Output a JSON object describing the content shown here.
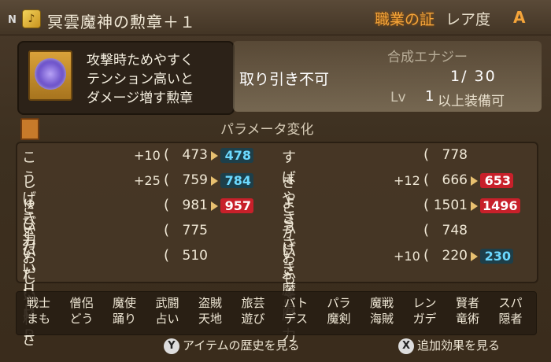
{
  "header": {
    "rank_badge": "N",
    "item_icon_glyph": "♪",
    "item_name": "冥雲魔神の勲章＋１",
    "job_proof": "職業の証",
    "rarity_label": "レア度",
    "rarity_value": "A"
  },
  "description": {
    "lines": [
      "攻撃時ためやすく",
      "テンション高いと",
      "ダメージ増す勲章"
    ]
  },
  "info": {
    "no_trade": "取り引き不可",
    "synth_label": "合成エナジー",
    "synth_value": "1/ 30",
    "lv_label": "Lv",
    "lv_value": "1",
    "lv_suffix": "以上装備可"
  },
  "params_title": "パラメータ変化",
  "params": {
    "left": [
      {
        "name": "こうげき力",
        "bonus": "+10",
        "cur": "473",
        "new": "478",
        "dir": "up"
      },
      {
        "name": "しゅび力",
        "bonus": "+25",
        "cur": "759",
        "new": "784",
        "dir": "up"
      },
      {
        "name": "さいだいＨＰ",
        "bonus": "",
        "cur": "981",
        "new": "957",
        "dir": "down"
      },
      {
        "name": "さいだいＭＰ",
        "bonus": "",
        "cur": "775",
        "new": "",
        "dir": ""
      },
      {
        "name": "おしゃれさ",
        "bonus": "",
        "cur": "510",
        "new": "",
        "dir": ""
      }
    ],
    "right": [
      {
        "name": "すばやさ",
        "bonus": "",
        "cur": "778",
        "new": "",
        "dir": ""
      },
      {
        "name": "きようさ",
        "bonus": "+12",
        "cur": "666",
        "new": "653",
        "dir": "down"
      },
      {
        "name": "こうげき魔力",
        "bonus": "",
        "cur": "1501",
        "new": "1496",
        "dir": "down"
      },
      {
        "name": "かいふく魔力",
        "bonus": "",
        "cur": "748",
        "new": "",
        "dir": ""
      },
      {
        "name": "おもさ",
        "bonus": "+10",
        "cur": "220",
        "new": "230",
        "dir": "up"
      }
    ]
  },
  "jobs": [
    [
      "戦士",
      "まも"
    ],
    [
      "僧侶",
      "どう"
    ],
    [
      "魔使",
      "踊り"
    ],
    [
      "武闘",
      "占い"
    ],
    [
      "盗賊",
      "天地"
    ],
    [
      "旅芸",
      "遊び"
    ],
    [
      "バト",
      "デス"
    ],
    [
      "パラ",
      "魔剣"
    ],
    [
      "魔戦",
      "海賊"
    ],
    [
      "レン",
      "ガデ"
    ],
    [
      "賢者",
      "竜術"
    ],
    [
      "スパ",
      "隠者"
    ]
  ],
  "buttons": {
    "history_key": "Y",
    "history_label": "アイテムの歴史を見る",
    "effect_key": "X",
    "effect_label": "追加効果を見る"
  },
  "colors": {
    "accent": "#f4a43a",
    "up": "#6cd9ff",
    "down": "#c8202a"
  }
}
